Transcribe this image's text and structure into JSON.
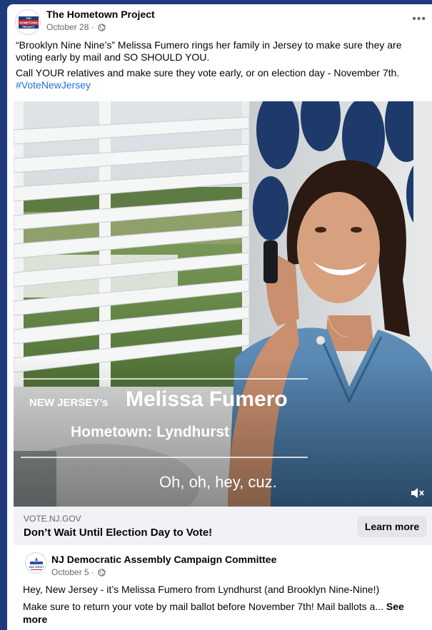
{
  "post": {
    "page_name": "The Hometown Project",
    "date": "October 28 ·",
    "text_1": "“Brooklyn Nine Nine’s” Melissa Fumero rings her family in Jersey to make sure they are voting early by mail and SO SHOULD YOU.",
    "text_2": "Call YOUR relatives and make sure they vote early, or on election day - November 7th.",
    "hashtag": "#VoteNewJersey",
    "avatar_text_top": "THE",
    "avatar_text_mid": "HOMETOWN",
    "avatar_text_bottom": "PROJECT"
  },
  "video": {
    "label_state": "NEW JERSEY’s",
    "label_name": "Melissa Fumero",
    "label_hometown": "Hometown: Lyndhurst",
    "caption": "Oh, oh,  hey, cuz."
  },
  "link": {
    "domain": "VOTE.NJ.GOV",
    "title": "Don’t Wait Until Election Day to Vote!",
    "button_label": "Learn more"
  },
  "shared": {
    "name": "NJ Democratic Assembly Campaign Committee",
    "date": "October 5 ·",
    "text_1": "Hey, New Jersey - it’s Melissa Fumero from Lyndhurst (and Brooklyn Nine-Nine!)",
    "text_2": "Make sure to return your vote by mail ballot before November 7th! Mail ballots a...",
    "see_more": "See more",
    "avatar_text": "NEW JERSEY"
  },
  "colors": {
    "background": "#1e3a7a",
    "link_bar": "#f0f2f5",
    "hashtag": "#216fdb",
    "button": "#e4e6eb"
  }
}
